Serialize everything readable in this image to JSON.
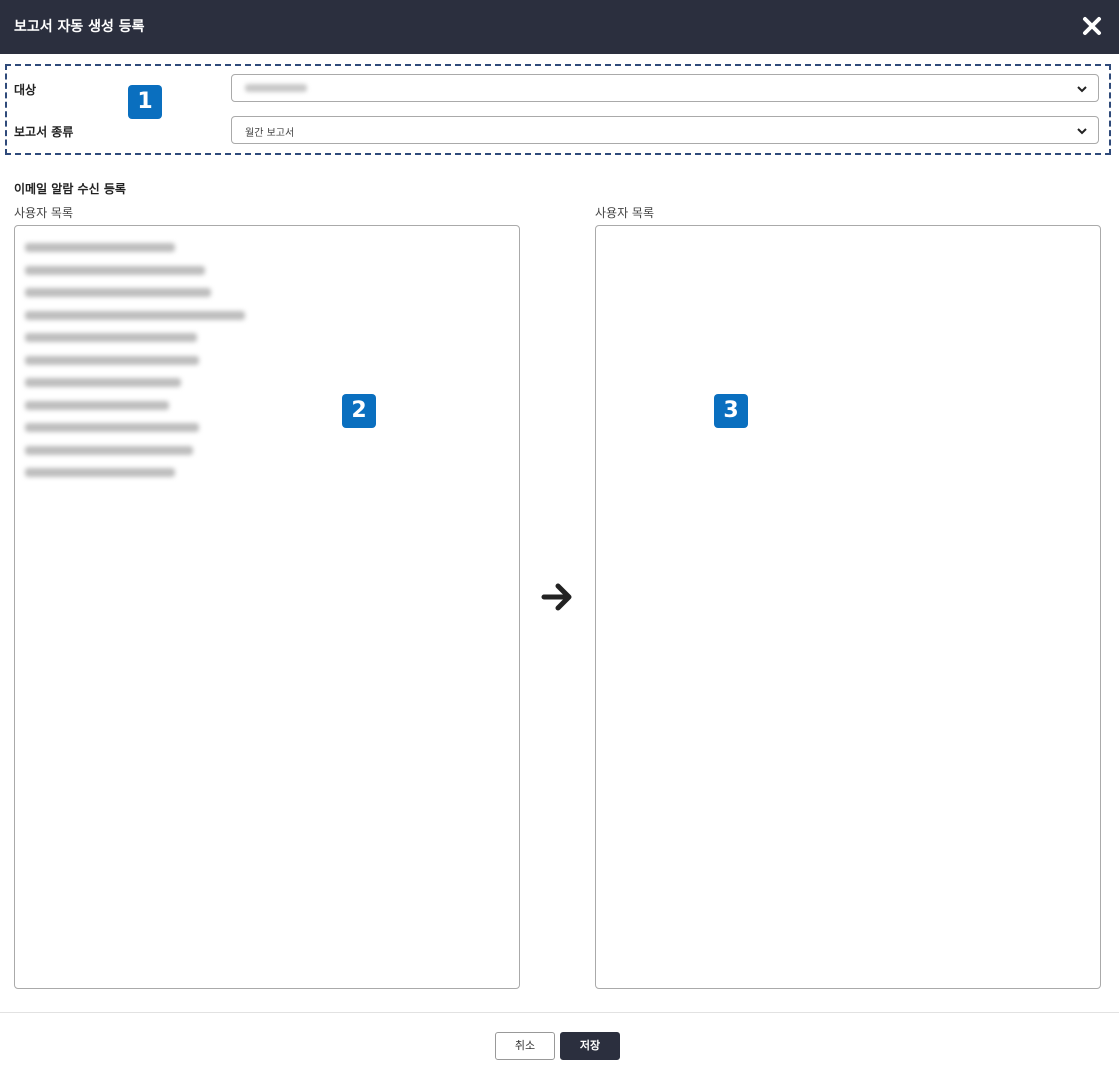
{
  "dialog": {
    "title": "보고서 자동 생성 등록",
    "close_icon": "close-icon"
  },
  "target_section": {
    "target_label": "대상",
    "target_value": "",
    "report_type_label": "보고서 종류",
    "report_type_value": "월간 보고서",
    "badge": "1"
  },
  "email_section": {
    "title": "이메일 알람 수신 등록",
    "left_list": {
      "label": "사용자 목록",
      "badge": "2",
      "items": [
        "",
        "",
        "",
        "",
        "",
        "",
        "",
        "",
        "",
        "",
        ""
      ]
    },
    "transfer_icon": "arrow-right-icon",
    "right_list": {
      "label": "사용자 목록",
      "badge": "3",
      "items": []
    }
  },
  "footer": {
    "cancel_label": "취소",
    "save_label": "저장"
  },
  "colors": {
    "header_bg": "#2b2f3e",
    "badge_bg": "#0a6fbf",
    "dashed_border": "#2f4a7a",
    "save_button_bg": "#2b2f3e"
  }
}
